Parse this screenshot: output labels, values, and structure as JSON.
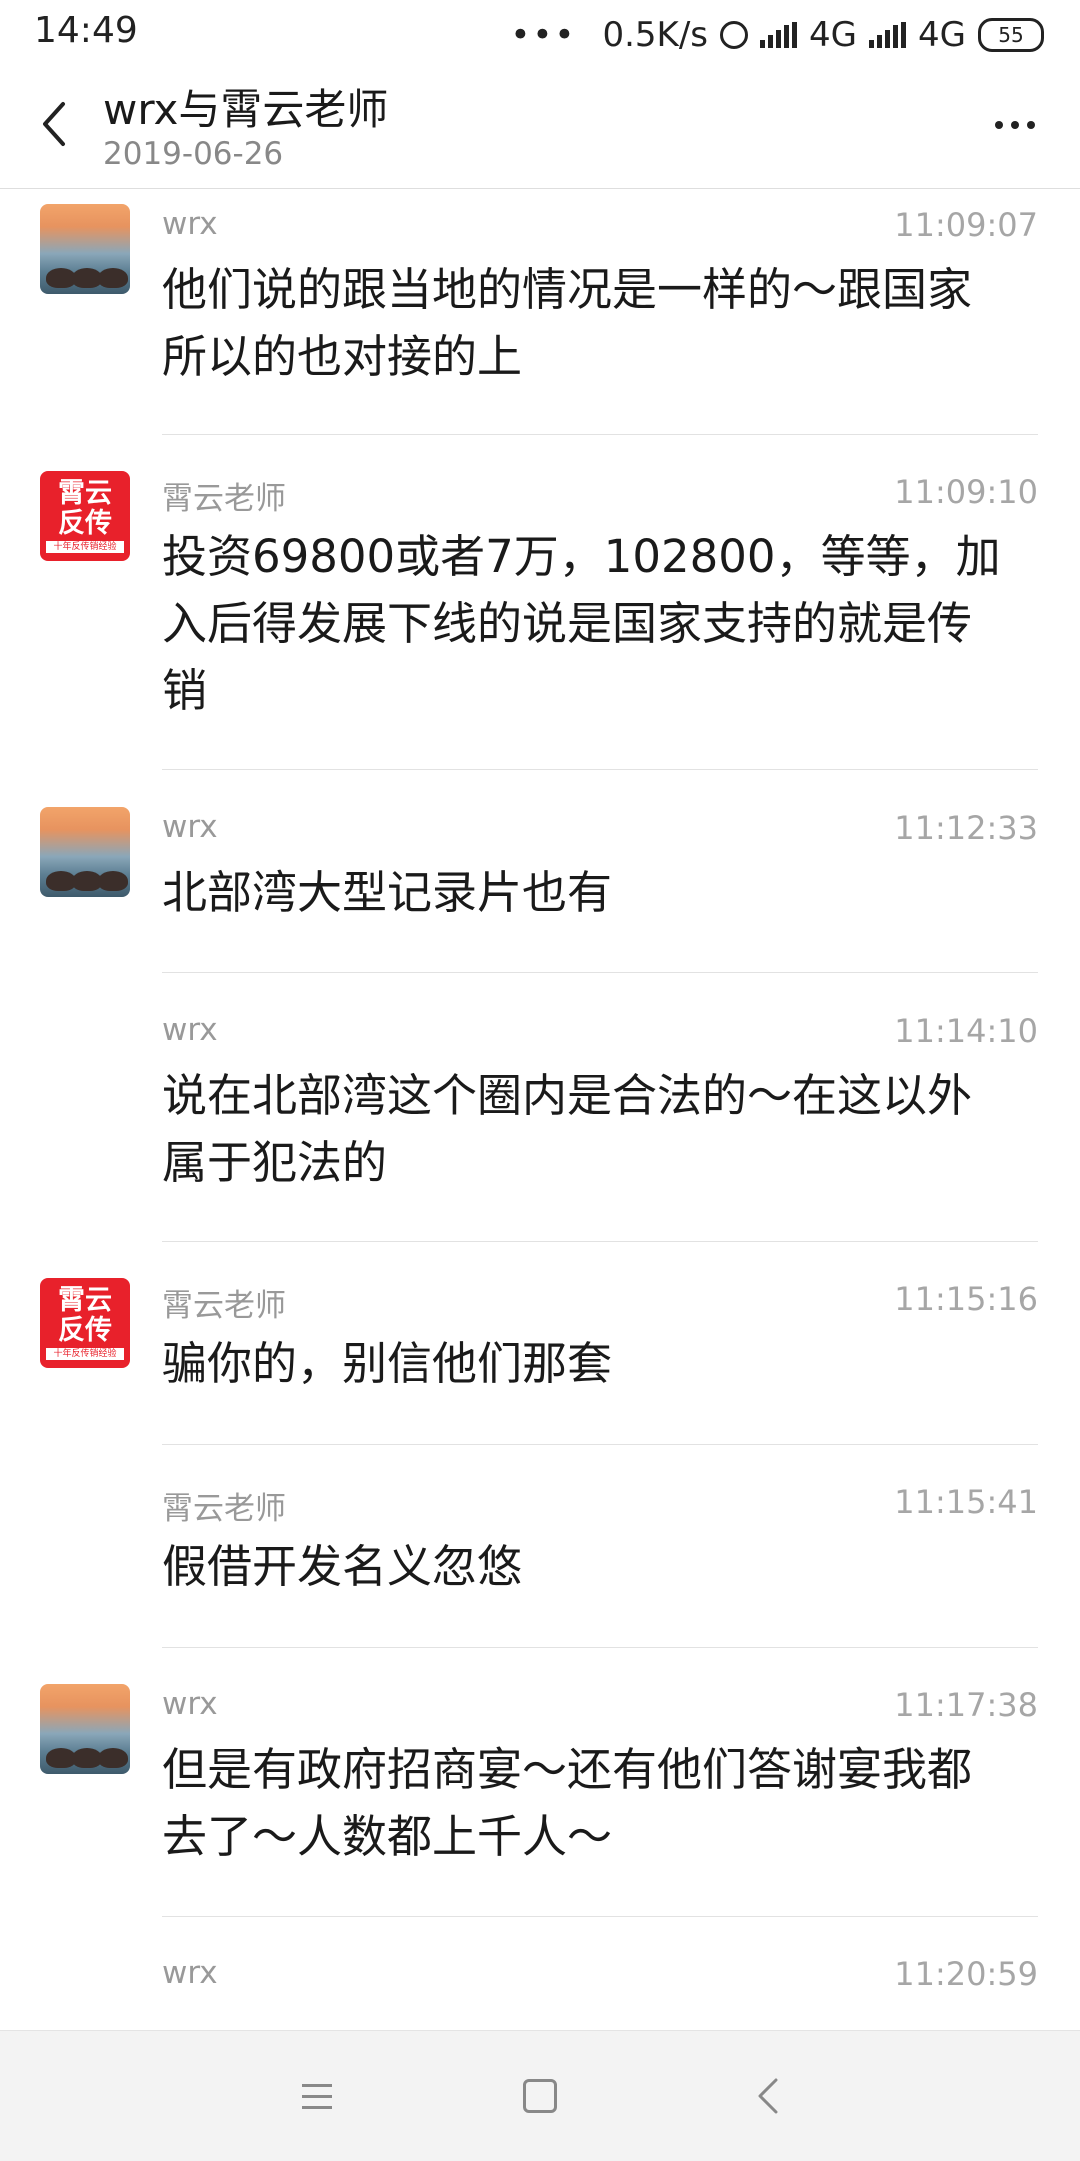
{
  "status_bar": {
    "time": "14:49",
    "dots": "•••",
    "speed": "0.5K/s",
    "network1": "4G",
    "network2": "4G",
    "battery": "55"
  },
  "header": {
    "title": "wrx与霄云老师",
    "date": "2019-06-26"
  },
  "messages": [
    {
      "sender": "wrx",
      "time": "11:09:07",
      "text": "他们说的跟当地的情况是一样的～跟国家所以的也对接的上"
    },
    {
      "sender": "霄云老师",
      "time": "11:09:10",
      "text": "投资69800或者7万，102800，等等，加入后得发展下线的说是国家支持的就是传销"
    },
    {
      "sender": "wrx",
      "time": "11:12:33",
      "text": "北部湾大型记录片也有"
    },
    {
      "sender": "wrx",
      "time": "11:14:10",
      "text": "说在北部湾这个圈内是合法的～在这以外属于犯法的"
    },
    {
      "sender": "霄云老师",
      "time": "11:15:16",
      "text": "骗你的，别信他们那套"
    },
    {
      "sender": "霄云老师",
      "time": "11:15:41",
      "text": "假借开发名义忽悠"
    },
    {
      "sender": "wrx",
      "time": "11:17:38",
      "text": "但是有政府招商宴～还有他们答谢宴我都去了～人数都上千人～"
    },
    {
      "sender": "wrx",
      "time": "11:20:59",
      "text": ""
    }
  ],
  "avatars": {
    "teacher": {
      "line1": "霄云",
      "line2": "反传",
      "line3": "十年反传销经验"
    }
  },
  "colors": {
    "avatar_red": "#e8212b",
    "meta_gray": "#a6a6a6"
  },
  "icons": {
    "back": "chevron-left-icon",
    "more": "more-horizontal-icon",
    "nav_menu": "menu-icon",
    "nav_home": "home-square-icon",
    "nav_back": "back-chevron-icon"
  }
}
